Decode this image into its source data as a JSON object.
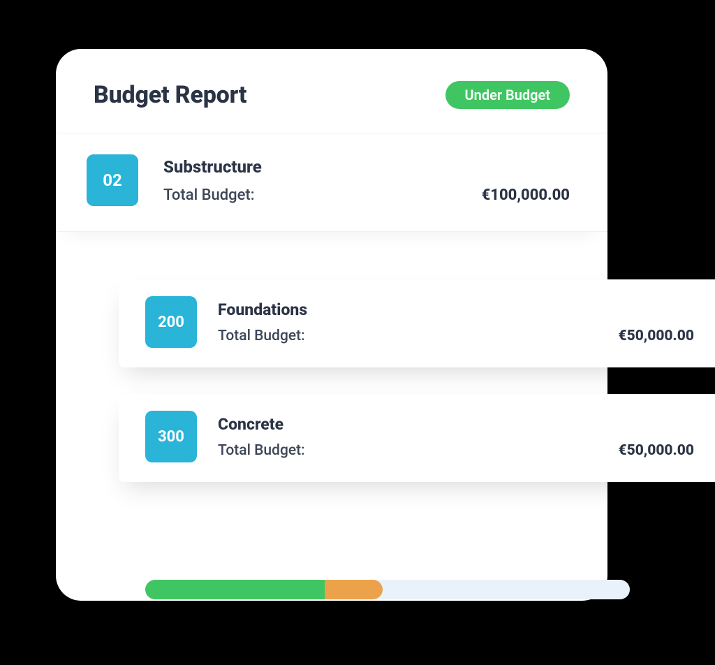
{
  "header": {
    "title": "Budget Report",
    "status_label": "Under Budget"
  },
  "section": {
    "code": "02",
    "name": "Substructure",
    "budget_label": "Total Budget:",
    "budget_value": "€100,000.00"
  },
  "sub_items": [
    {
      "code": "200",
      "name": "Foundations",
      "budget_label": "Total Budget:",
      "budget_value": "€50,000.00"
    },
    {
      "code": "300",
      "name": "Concrete",
      "budget_label": "Total Budget:",
      "budget_value": "€50,000.00"
    }
  ],
  "progress": {
    "green_pct": 37,
    "orange_end_pct": 49
  },
  "colors": {
    "green": "#3fc662",
    "orange": "#eca24a",
    "cyan": "#29b4d8",
    "track": "#e9f2fb",
    "text": "#2b3445"
  }
}
